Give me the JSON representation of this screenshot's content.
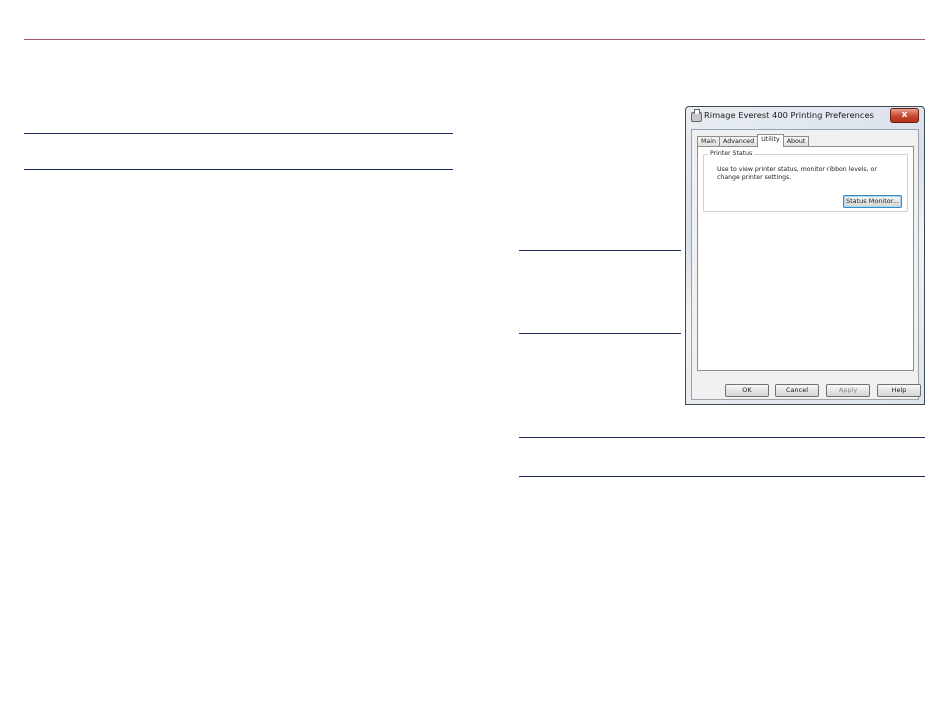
{
  "dialog": {
    "title": "Rimage Everest 400 Printing Preferences",
    "close_label": "x",
    "tabs": [
      {
        "label": "Main"
      },
      {
        "label": "Advanced"
      },
      {
        "label": "Utility"
      },
      {
        "label": "About"
      }
    ],
    "active_tab": "Utility",
    "group": {
      "label": "Printer Status",
      "description": "Use to view printer status, monitor ribbon levels, or change printer settings.",
      "button": "Status Monitor..."
    },
    "buttons": {
      "ok": "OK",
      "cancel": "Cancel",
      "apply": "Apply",
      "help": "Help"
    }
  },
  "colors": {
    "top_rule": "#9b5a6e",
    "section_rule": "#1f2a5c"
  }
}
